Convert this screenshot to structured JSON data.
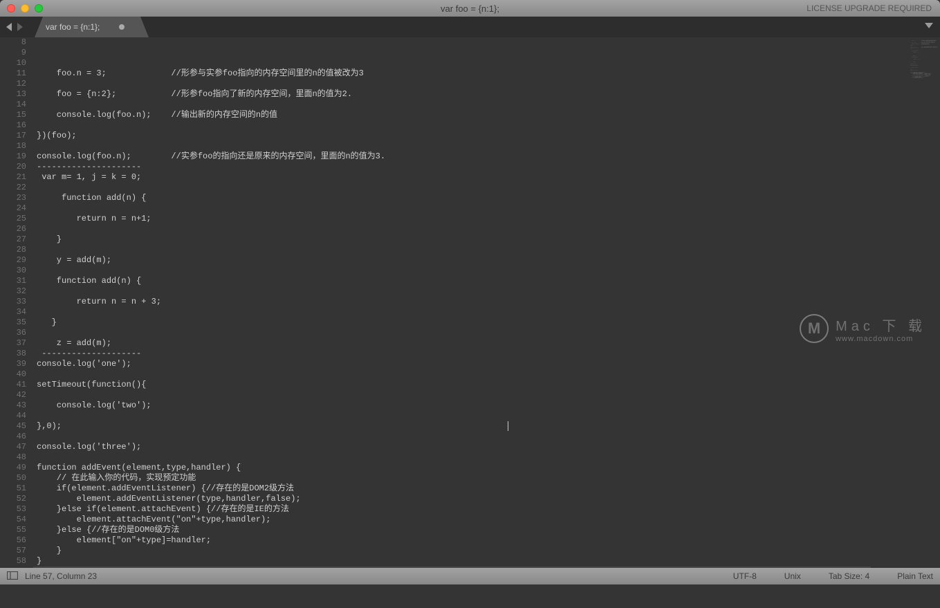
{
  "titlebar": {
    "title": "var foo = {n:1};",
    "upgrade": "LICENSE UPGRADE REQUIRED"
  },
  "tab": {
    "label": "var foo = {n:1};"
  },
  "gutter": {
    "start": 8,
    "end": 58
  },
  "code": {
    "lines": [
      "",
      "    foo.n = 3;             //形参与实参foo指向的内存空间里的n的值被改为3",
      "",
      "    foo = {n:2};           //形参foo指向了新的内存空间，里面n的值为2.",
      "",
      "    console.log(foo.n);    //输出新的内存空间的n的值",
      "",
      "})(foo);",
      "",
      "console.log(foo.n);        //实参foo的指向还是原来的内存空间，里面的n的值为3.",
      "---------------------",
      " var m= 1, j = k = 0;",
      "",
      "     function add(n) {",
      "",
      "        return n = n+1;",
      "",
      "    }",
      "",
      "    y = add(m);",
      "",
      "    function add(n) {",
      "",
      "        return n = n + 3;",
      "",
      "   }",
      "",
      "    z = add(m);",
      " --------------------",
      "console.log('one');",
      "",
      "setTimeout(function(){",
      "",
      "    console.log('two');",
      "",
      "},0);",
      "",
      "console.log('three');",
      "",
      "function addEvent(element,type,handler) {",
      "    // 在此输入你的代码，实现预定功能",
      "    if(element.addEventListener) {//存在的是DOM2级方法",
      "        element.addEventListener(type,handler,false);",
      "    }else if(element.attachEvent) {//存在的是IE的方法",
      "        element.attachEvent(\"on\"+type,handler);",
      "    }else {//存在的是DOM0级方法",
      "        element[\"on\"+type]=handler;",
      "    }",
      "}",
      "---------------------",
      ""
    ],
    "highlighted_index": 49
  },
  "watermark": {
    "icon_letter": "M",
    "main": "Mac 下 载",
    "sub": "www.macdown.com"
  },
  "status": {
    "position": "Line 57, Column 23",
    "encoding": "UTF-8",
    "line_ending": "Unix",
    "tab_size": "Tab Size: 4",
    "syntax": "Plain Text"
  }
}
